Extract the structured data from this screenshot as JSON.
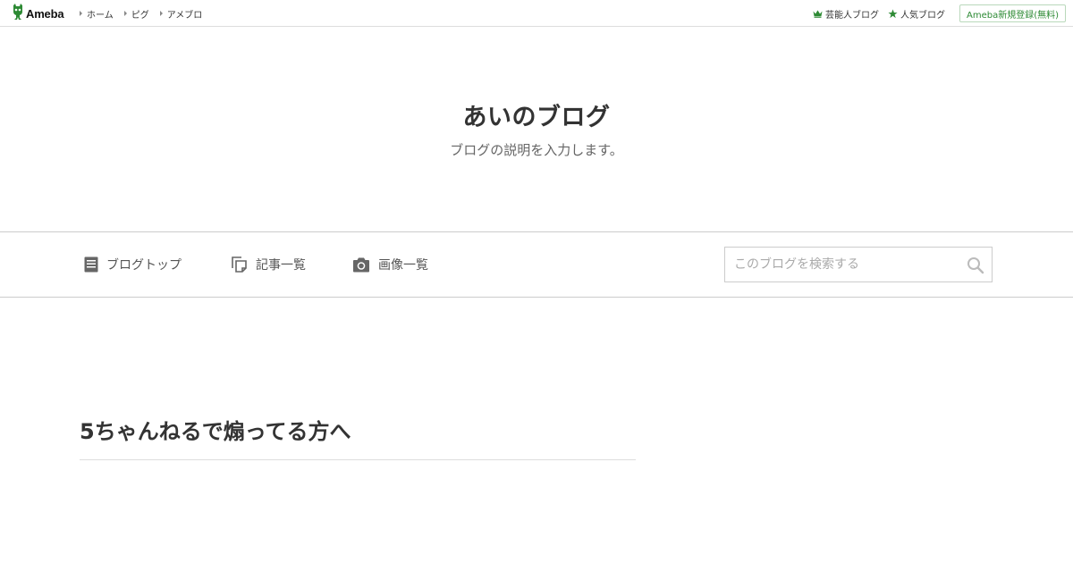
{
  "topbar": {
    "logo_text": "Ameba",
    "nav": [
      {
        "label": "ホーム"
      },
      {
        "label": "ピグ"
      },
      {
        "label": "アメブロ"
      }
    ],
    "right_links": [
      {
        "label": "芸能人ブログ",
        "icon": "crown-icon"
      },
      {
        "label": "人気ブログ",
        "icon": "star-icon"
      }
    ],
    "signup_label": "Ameba新規登録(無料)"
  },
  "blog": {
    "title": "あいのブログ",
    "description": "ブログの説明を入力します。"
  },
  "menu": {
    "items": [
      {
        "label": "ブログトップ",
        "icon": "document-icon"
      },
      {
        "label": "記事一覧",
        "icon": "copy-icon"
      },
      {
        "label": "画像一覧",
        "icon": "camera-icon"
      }
    ],
    "search_placeholder": "このブログを検索する",
    "search_value": ""
  },
  "article": {
    "title": "5ちゃんねるで煽ってる方へ"
  },
  "colors": {
    "brand_green": "#2d8a34",
    "text": "#333333",
    "muted": "#666666",
    "border": "#cccccc"
  }
}
